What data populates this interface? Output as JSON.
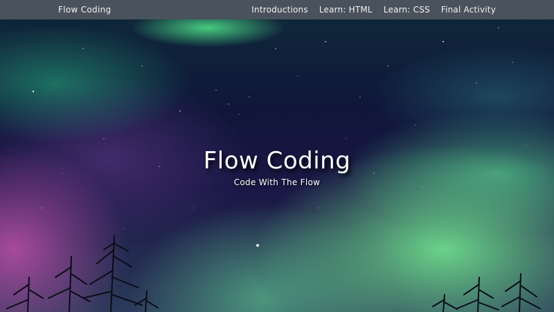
{
  "navbar": {
    "brand": "Flow Coding",
    "links": [
      {
        "label": "Introductions"
      },
      {
        "label": "Learn: HTML"
      },
      {
        "label": "Learn: CSS"
      },
      {
        "label": "Final Activity"
      }
    ]
  },
  "hero": {
    "title": "Flow Coding",
    "subtitle": "Code With The Flow"
  },
  "colors": {
    "navbar_bg": "#4a525d",
    "text": "#ffffff",
    "aurora_green": "#6edc8c",
    "aurora_magenta": "#be50aa",
    "night_sky": "#10163a"
  }
}
